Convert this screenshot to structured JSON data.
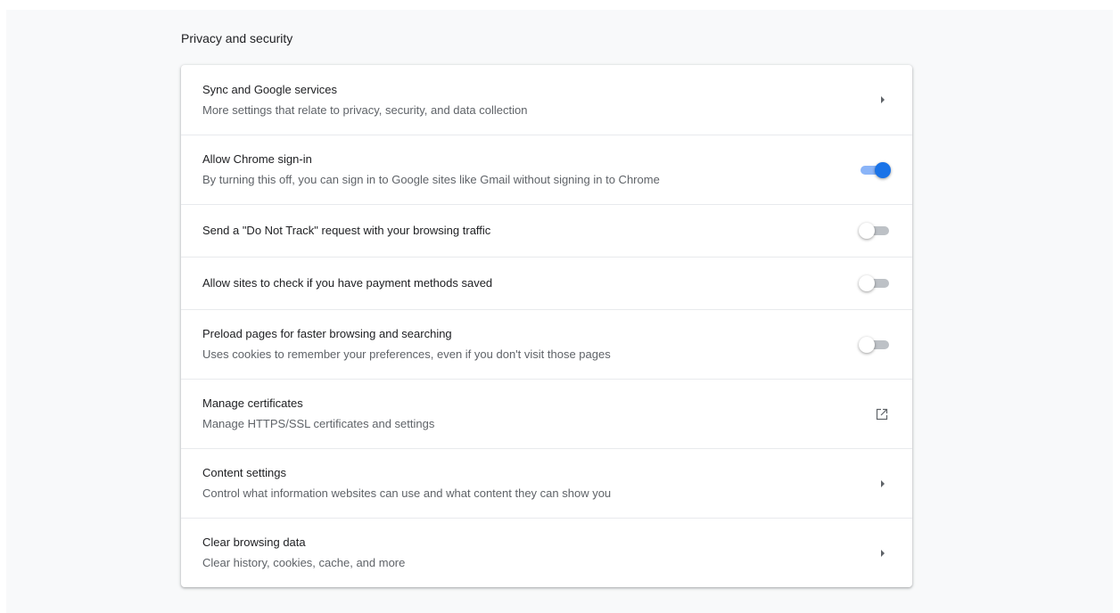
{
  "section": {
    "title": "Privacy and security"
  },
  "rows": [
    {
      "label": "Sync and Google services",
      "sublabel": "More settings that relate to privacy, security, and data collection",
      "control": "arrow"
    },
    {
      "label": "Allow Chrome sign-in",
      "sublabel": "By turning this off, you can sign in to Google sites like Gmail without signing in to Chrome",
      "control": "toggle",
      "checked": true
    },
    {
      "label": "Send a \"Do Not Track\" request with your browsing traffic",
      "control": "toggle",
      "checked": false
    },
    {
      "label": "Allow sites to check if you have payment methods saved",
      "control": "toggle",
      "checked": false
    },
    {
      "label": "Preload pages for faster browsing and searching",
      "sublabel": "Uses cookies to remember your preferences, even if you don't visit those pages",
      "control": "toggle",
      "checked": false
    },
    {
      "label": "Manage certificates",
      "sublabel": "Manage HTTPS/SSL certificates and settings",
      "control": "external-link"
    },
    {
      "label": "Content settings",
      "sublabel": "Control what information websites can use and what content they can show you",
      "control": "arrow"
    },
    {
      "label": "Clear browsing data",
      "sublabel": "Clear history, cookies, cache, and more",
      "control": "arrow"
    }
  ],
  "colors": {
    "accent": "#1a73e8",
    "accent_track": "#8ab4f8",
    "off_track": "#bdc1c6",
    "page_background": "#f8f9fa",
    "secondary_text": "#5f6368"
  },
  "icons": {
    "arrow": "arrow-right-icon",
    "external": "external-link-icon"
  }
}
